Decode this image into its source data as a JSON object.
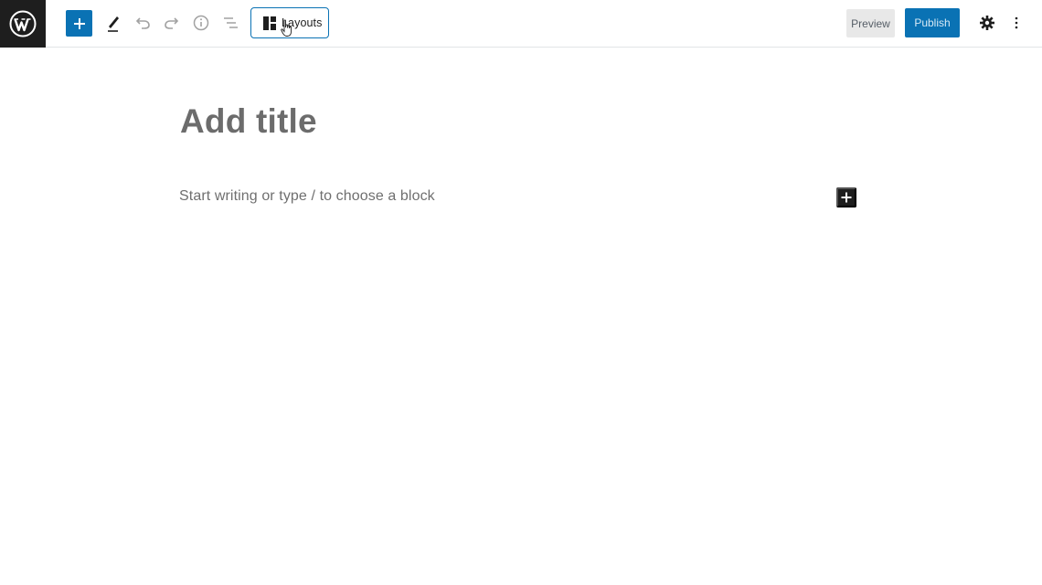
{
  "toolbar": {
    "logo_icon": "wordpress-logo-icon",
    "add_block_icon": "plus-icon",
    "edit_icon": "pencil-icon",
    "undo_icon": "undo-icon",
    "redo_icon": "redo-icon",
    "info_icon": "info-icon",
    "outline_icon": "list-outline-icon",
    "layouts": {
      "icon": "layouts-grid-icon",
      "label": "Layouts"
    },
    "preview_label": "Preview",
    "publish_label": "Publish",
    "settings_icon": "gear-icon",
    "more_icon": "more-vertical-icon"
  },
  "editor": {
    "title_placeholder": "Add title",
    "block_placeholder": "Start writing or type / to choose a block",
    "inline_add_icon": "plus-icon"
  },
  "colors": {
    "accent": "#0a72b4",
    "dark": "#1e1e1e",
    "placeholder_text": "#6c6c6c"
  }
}
